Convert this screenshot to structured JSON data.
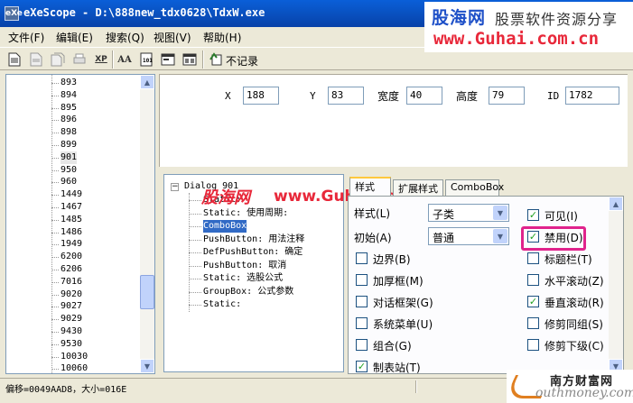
{
  "window": {
    "title": "eXeScope - D:\\888new_tdx0628\\TdxW.exe",
    "app_icon": "eXe"
  },
  "watermark_top": {
    "brand": "股海网",
    "slogan": "股票软件资源分享",
    "url": "www.Guhai.com.cn"
  },
  "menu": [
    {
      "label": "文件(F)"
    },
    {
      "label": "编辑(E)"
    },
    {
      "label": "搜索(Q)"
    },
    {
      "label": "视图(V)"
    },
    {
      "label": "帮助(H)"
    }
  ],
  "toolbar": {
    "icons": [
      "new-file-icon",
      "save-icon",
      "save-all-icon",
      "print-icon",
      "xp-icon",
      "font-icon",
      "binary-icon",
      "dialog-icon",
      "form-icon",
      "no-record-icon"
    ],
    "xp_label": "XP",
    "font_label": "AA",
    "norecord_label": "不记录"
  },
  "left_tree": {
    "items": [
      "893",
      "894",
      "895",
      "896",
      "898",
      "899",
      "901",
      "950",
      "960",
      "1449",
      "1467",
      "1485",
      "1486",
      "1949",
      "6200",
      "6206",
      "7016",
      "9020",
      "9027",
      "9029",
      "9430",
      "9530",
      "10030",
      "10060"
    ],
    "selected": "901"
  },
  "fields": {
    "x_label": "X",
    "x_value": "188",
    "y_label": "Y",
    "y_value": "83",
    "width_label": "宽度",
    "width_value": "40",
    "height_label": "高度",
    "height_value": "79",
    "id_label": "ID",
    "id_value": "1782"
  },
  "dialog_tree": {
    "root": "Dialog 901",
    "items": [
      "Static:",
      "Static: 使用周期:",
      "ComboBox",
      "PushButton: 用法注释",
      "DefPushButton: 确定",
      "PushButton: 取消",
      "Static: 选股公式",
      "GroupBox: 公式参数",
      "Static:"
    ],
    "selected": "ComboBox"
  },
  "watermark_mid": {
    "brand": "股海网",
    "url": "www.Guhai.com.cn"
  },
  "tabs": [
    {
      "label": "样式",
      "active": true
    },
    {
      "label": "扩展样式",
      "active": false
    },
    {
      "label": "ComboBox",
      "active": false
    }
  ],
  "style_tab": {
    "style_label": "样式(L)",
    "style_value": "子类",
    "initial_label": "初始(A)",
    "initial_value": "普通",
    "checkboxes_left": [
      {
        "label": "边界(B)",
        "checked": false
      },
      {
        "label": "加厚框(M)",
        "checked": false
      },
      {
        "label": "对话框架(G)",
        "checked": false
      },
      {
        "label": "系统菜单(U)",
        "checked": false
      },
      {
        "label": "组合(G)",
        "checked": false
      },
      {
        "label": "制表站(T)",
        "checked": true
      }
    ],
    "checkboxes_right": [
      {
        "label": "可见(I)",
        "checked": true
      },
      {
        "label": "禁用(D)",
        "checked": true
      },
      {
        "label": "标题栏(T)",
        "checked": false
      },
      {
        "label": "水平滚动(Z)",
        "checked": false
      },
      {
        "label": "垂直滚动(R)",
        "checked": true
      },
      {
        "label": "修剪同组(S)",
        "checked": false
      },
      {
        "label": "修剪下级(C)",
        "checked": false
      }
    ]
  },
  "status": {
    "text": "偏移=0049AAD8，大小=016E"
  },
  "watermark_bottom": {
    "name": "南方财富网",
    "url": "outhmoney.com"
  },
  "colors": {
    "titlebar": "#0A5FD8",
    "selection": "#316AC5",
    "highlight_box": "#E0238C",
    "watermark_red": "#E8283A",
    "check_green": "#21A121"
  }
}
